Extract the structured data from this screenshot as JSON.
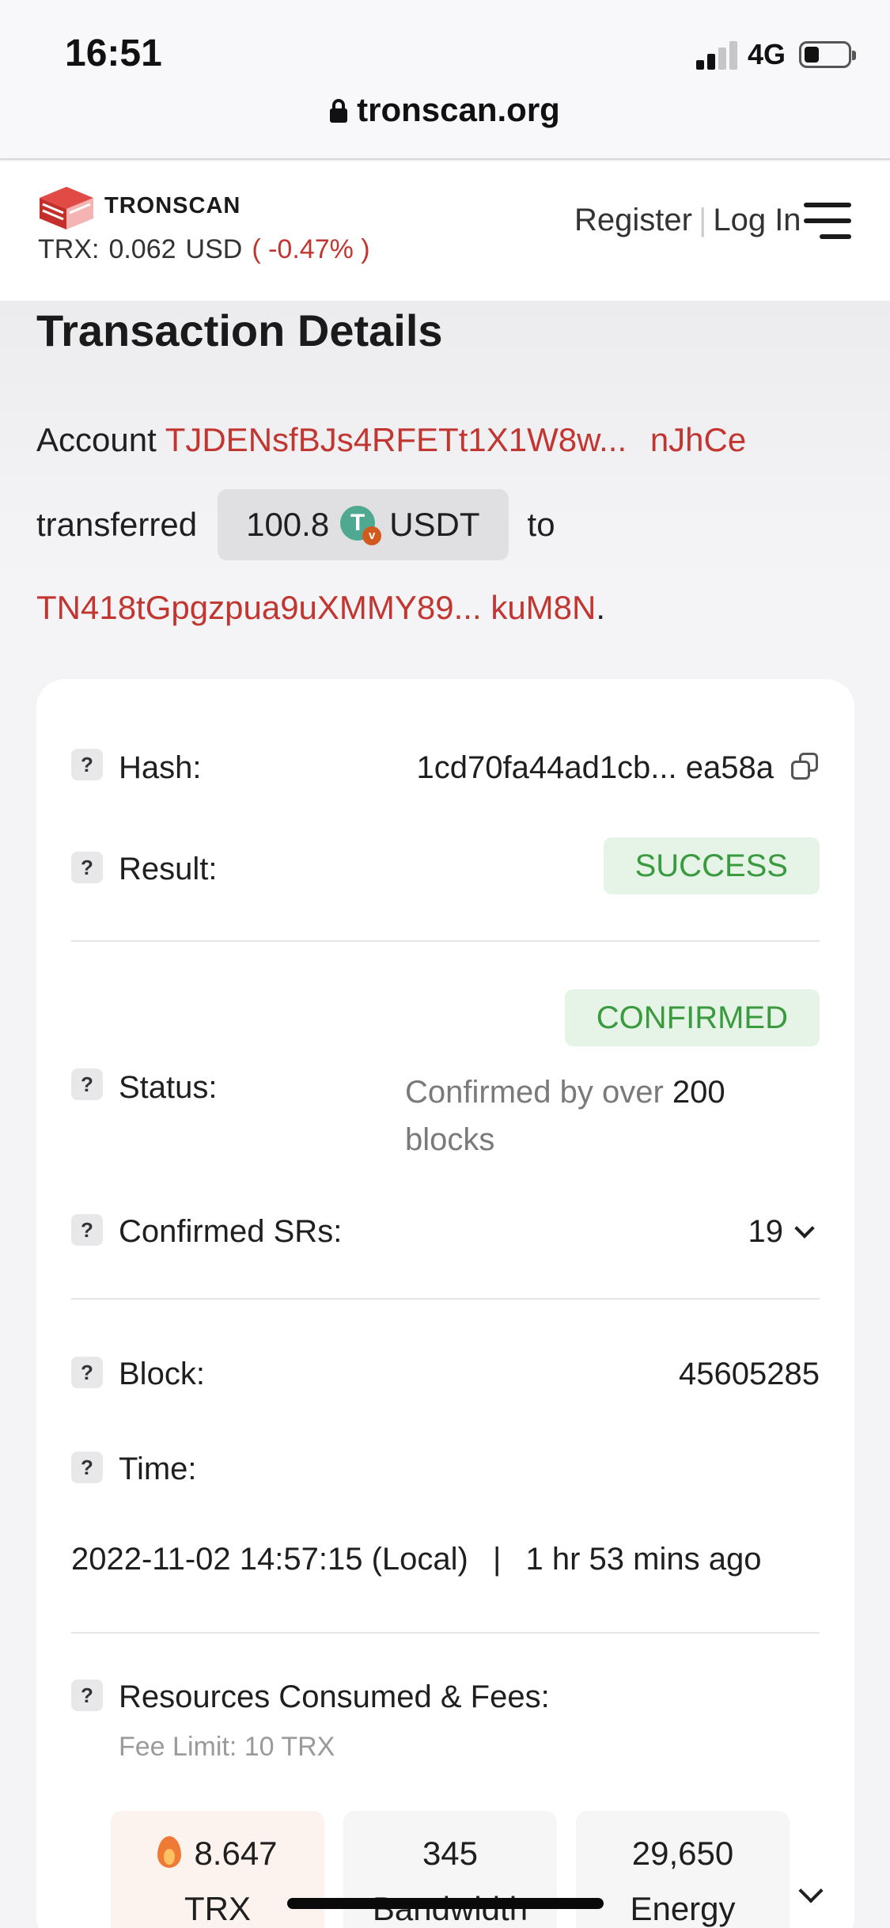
{
  "status_bar": {
    "time": "16:51",
    "network": "4G"
  },
  "browser": {
    "url": "tronscan.org"
  },
  "header": {
    "brand": "TRONSCAN",
    "price_label": "TRX:",
    "price_value": "0.062",
    "price_currency": "USD",
    "price_change": "( -0.47% )",
    "register": "Register",
    "separator": "|",
    "login": "Log In"
  },
  "page": {
    "title": "Transaction Details"
  },
  "summary": {
    "account_label": "Account",
    "from_address": "TJDENsfBJs4RFETt1X1W8w...",
    "from_address_end": "nJhCe",
    "transferred_label": "transferred",
    "amount": "100.8",
    "token": "USDT",
    "to_label": "to",
    "to_address": "TN418tGpgzpua9uXMMY89...",
    "to_address_end": "kuM8N",
    "period": "."
  },
  "details": {
    "hash_label": "Hash:",
    "hash_value": "1cd70fa44ad1cb... ea58a",
    "result_label": "Result:",
    "result_value": "SUCCESS",
    "status_label": "Status:",
    "status_value": "CONFIRMED",
    "confirmed_by_prefix": "Confirmed by over",
    "confirmed_by_count": "200",
    "confirmed_by_suffix": "blocks",
    "srs_label": "Confirmed SRs:",
    "srs_value": "19",
    "block_label": "Block:",
    "block_value": "45605285",
    "time_label": "Time:",
    "time_value": "2022-11-02 14:57:15 (Local)",
    "time_sep": "|",
    "time_ago": "1 hr 53 mins ago",
    "resources_label": "Resources Consumed & Fees:",
    "fee_limit": "Fee Limit: 10 TRX",
    "help_glyph": "?"
  },
  "resources": [
    {
      "value": "8.647",
      "unit": "TRX",
      "icon": "flame-icon"
    },
    {
      "value": "345",
      "unit": "Bandwidth"
    },
    {
      "value": "29,650",
      "unit": "Energy"
    }
  ],
  "colors": {
    "accent_red": "#c23631",
    "success_green": "#3a9a3e",
    "success_bg": "#e6f4e8"
  }
}
